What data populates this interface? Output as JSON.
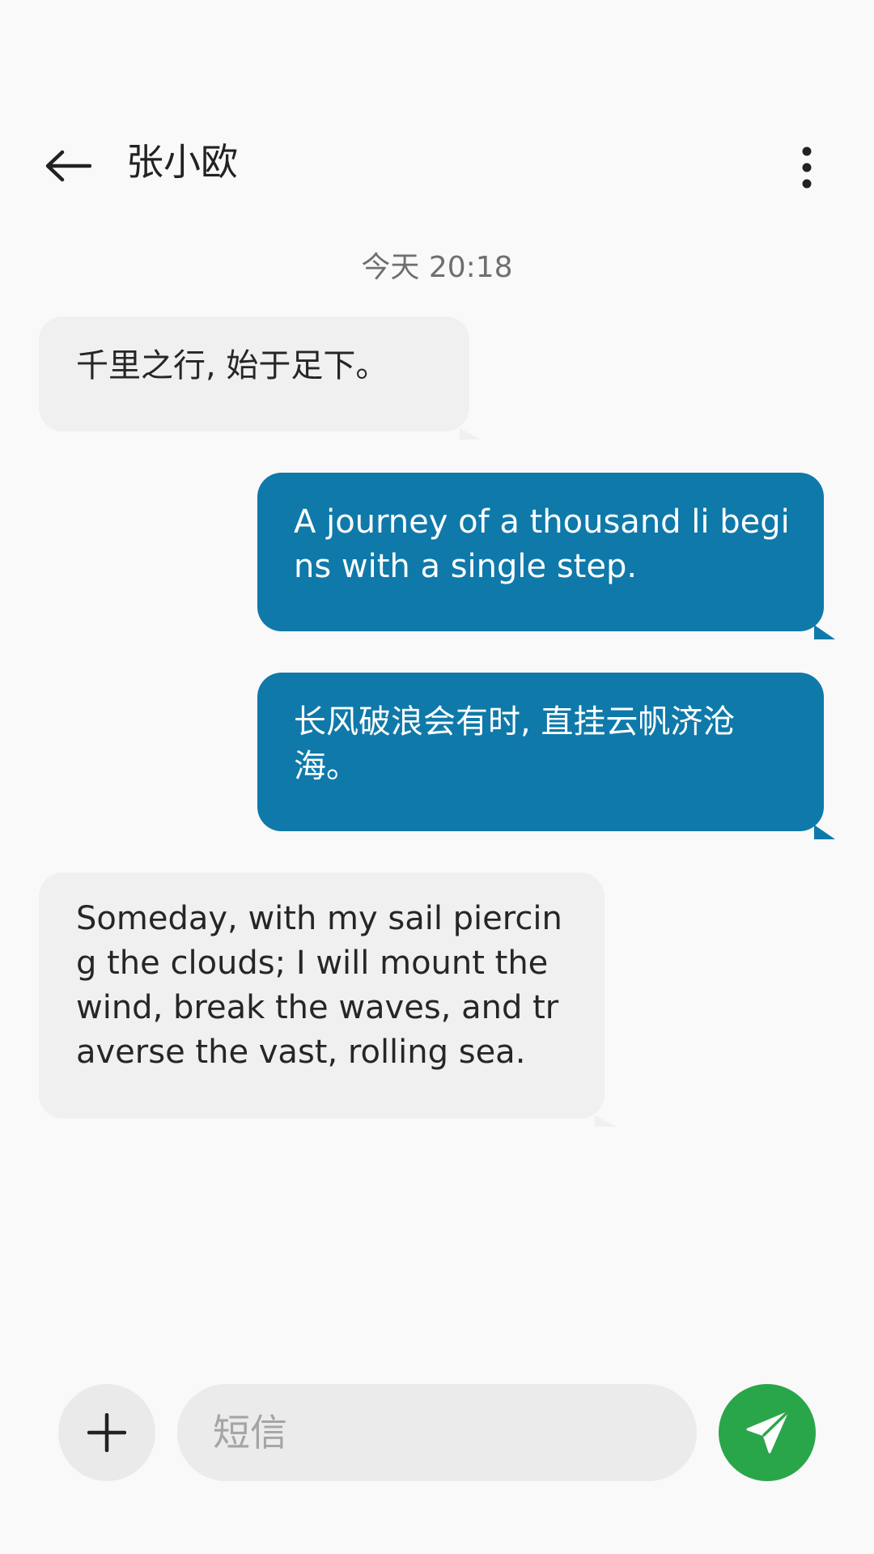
{
  "header": {
    "contact_name": "张小欧",
    "back_icon": "arrow-left-icon",
    "menu_icon": "more-vertical-icon"
  },
  "conversation": {
    "timestamp": "今天 20:18",
    "messages": [
      {
        "direction": "incoming",
        "text": "千里之行, 始于足下。"
      },
      {
        "direction": "outgoing",
        "text": "A journey of a thousand li begins with a single step."
      },
      {
        "direction": "outgoing",
        "text": "长风破浪会有时, 直挂云帆济沧海。"
      },
      {
        "direction": "incoming",
        "text": "Someday, with my sail piercing the clouds; I will mount the wind, break the waves, and traverse the vast, rolling sea."
      }
    ]
  },
  "composer": {
    "placeholder": "短信",
    "value": "",
    "add_icon": "plus-icon",
    "send_icon": "send-icon"
  },
  "colors": {
    "background": "#f9f9f9",
    "incoming_bubble": "#f0f0f0",
    "outgoing_bubble": "#0f79aa",
    "send_button": "#29a64a",
    "timestamp_text": "#6f6f6f"
  }
}
